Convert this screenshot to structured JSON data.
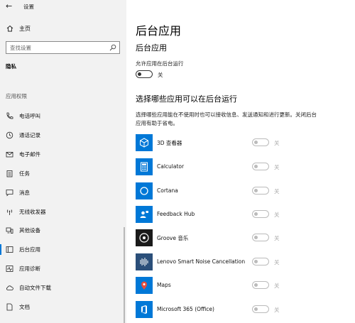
{
  "window": {
    "title": "设置",
    "back_icon": "back-arrow-icon"
  },
  "sidebar": {
    "home_label": "主页",
    "search_placeholder": "查找设置",
    "section_privacy": "隐私",
    "section_permissions": "应用权限",
    "items": [
      {
        "label": "电话呼叫",
        "icon": "phone-icon"
      },
      {
        "label": "通话记录",
        "icon": "call-history-icon"
      },
      {
        "label": "电子邮件",
        "icon": "mail-icon"
      },
      {
        "label": "任务",
        "icon": "tasks-icon"
      },
      {
        "label": "消息",
        "icon": "message-icon"
      },
      {
        "label": "无线收发器",
        "icon": "radio-icon"
      },
      {
        "label": "其他设备",
        "icon": "devices-icon"
      },
      {
        "label": "后台应用",
        "icon": "background-apps-icon",
        "selected": true
      },
      {
        "label": "应用诊断",
        "icon": "diagnostics-icon"
      },
      {
        "label": "自动文件下载",
        "icon": "cloud-icon"
      },
      {
        "label": "文档",
        "icon": "document-icon"
      }
    ]
  },
  "main": {
    "title": "后台应用",
    "subtitle": "后台应用",
    "allow_label": "允许应用在后台运行",
    "allow_state": "关",
    "section_heading": "选择哪些应用可以在后台运行",
    "description": "选择哪些应用能在不使用时也可以接收信息、发送通知和进行更新。关闭后台应用有助于省电。",
    "apps": [
      {
        "name": "3D 查看器",
        "state": "关",
        "icon": "cube-icon"
      },
      {
        "name": "Calculator",
        "state": "关",
        "icon": "calculator-icon"
      },
      {
        "name": "Cortana",
        "state": "关",
        "icon": "cortana-icon"
      },
      {
        "name": "Feedback Hub",
        "state": "关",
        "icon": "feedback-icon"
      },
      {
        "name": "Groove 音乐",
        "state": "关",
        "icon": "groove-icon"
      },
      {
        "name": "Lenovo Smart Noise Cancellation",
        "state": "关",
        "icon": "waveform-icon"
      },
      {
        "name": "Maps",
        "state": "关",
        "icon": "map-pin-icon"
      },
      {
        "name": "Microsoft 365 (Office)",
        "state": "关",
        "icon": "office-icon"
      }
    ]
  },
  "colors": {
    "accent": "#0078d7",
    "sidebar_bg": "#f2f2f2"
  }
}
